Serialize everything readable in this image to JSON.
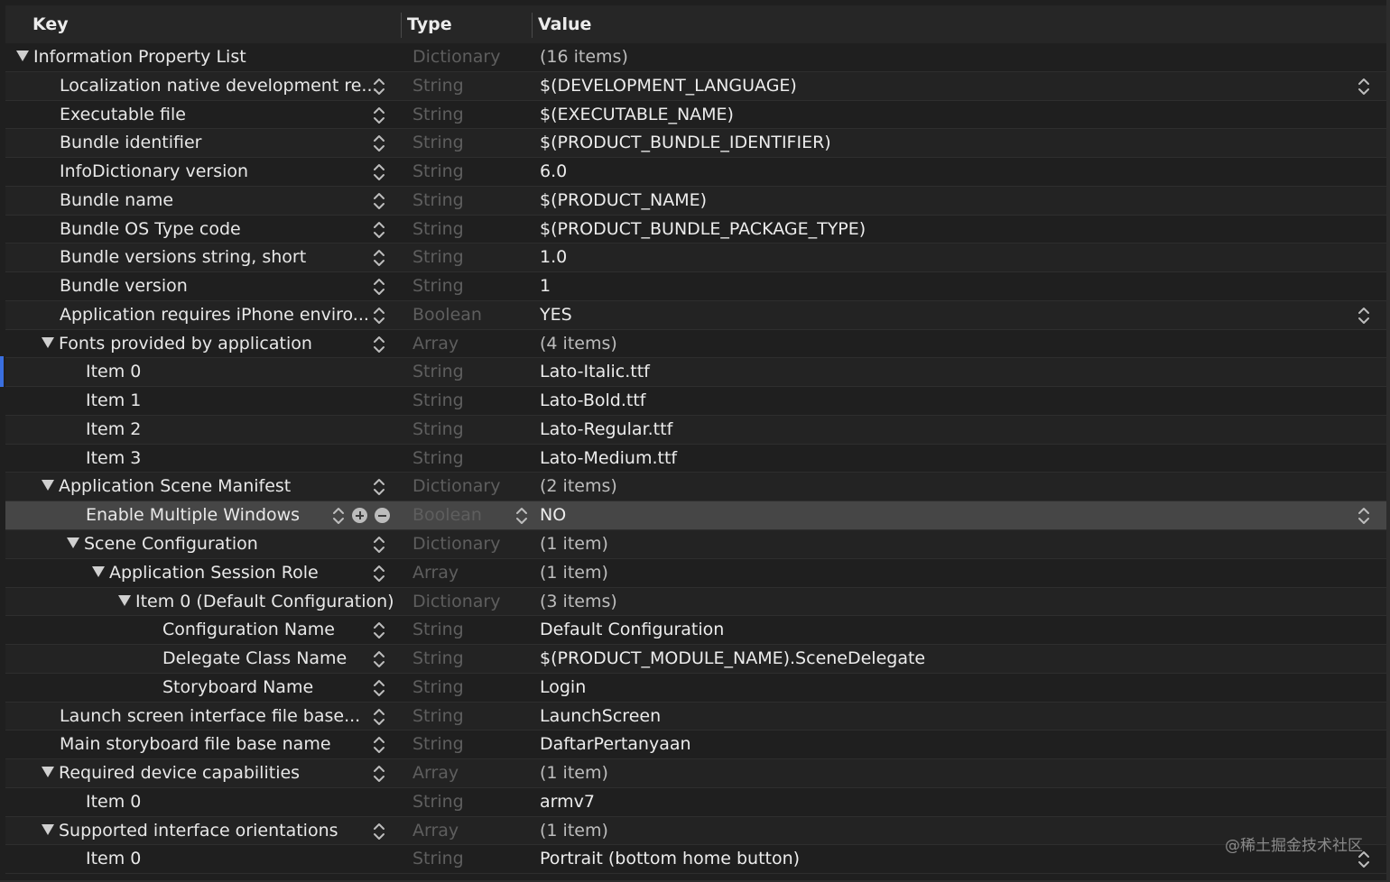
{
  "header": {
    "key_label": "Key",
    "type_label": "Type",
    "value_label": "Value"
  },
  "rows": [
    {
      "key": "Information Property List",
      "type": "Dictionary",
      "value": "(16 items)"
    },
    {
      "key": "Localization native development re...",
      "type": "String",
      "value": "$(DEVELOPMENT_LANGUAGE)"
    },
    {
      "key": "Executable file",
      "type": "String",
      "value": "$(EXECUTABLE_NAME)"
    },
    {
      "key": "Bundle identifier",
      "type": "String",
      "value": "$(PRODUCT_BUNDLE_IDENTIFIER)"
    },
    {
      "key": "InfoDictionary version",
      "type": "String",
      "value": "6.0"
    },
    {
      "key": "Bundle name",
      "type": "String",
      "value": "$(PRODUCT_NAME)"
    },
    {
      "key": "Bundle OS Type code",
      "type": "String",
      "value": "$(PRODUCT_BUNDLE_PACKAGE_TYPE)"
    },
    {
      "key": "Bundle versions string, short",
      "type": "String",
      "value": "1.0"
    },
    {
      "key": "Bundle version",
      "type": "String",
      "value": "1"
    },
    {
      "key": "Application requires iPhone enviro...",
      "type": "Boolean",
      "value": "YES"
    },
    {
      "key": "Fonts provided by application",
      "type": "Array",
      "value": "(4 items)"
    },
    {
      "key": "Item 0",
      "type": "String",
      "value": "Lato-Italic.ttf"
    },
    {
      "key": "Item 1",
      "type": "String",
      "value": "Lato-Bold.ttf"
    },
    {
      "key": "Item 2",
      "type": "String",
      "value": "Lato-Regular.ttf"
    },
    {
      "key": "Item 3",
      "type": "String",
      "value": "Lato-Medium.ttf"
    },
    {
      "key": "Application Scene Manifest",
      "type": "Dictionary",
      "value": "(2 items)"
    },
    {
      "key": "Enable Multiple Windows",
      "type": "Boolean",
      "value": "NO"
    },
    {
      "key": "Scene Configuration",
      "type": "Dictionary",
      "value": "(1 item)"
    },
    {
      "key": "Application Session Role",
      "type": "Array",
      "value": "(1 item)"
    },
    {
      "key": "Item 0 (Default Configuration)",
      "type": "Dictionary",
      "value": "(3 items)"
    },
    {
      "key": "Configuration Name",
      "type": "String",
      "value": "Default Configuration"
    },
    {
      "key": "Delegate Class Name",
      "type": "String",
      "value": "$(PRODUCT_MODULE_NAME).SceneDelegate"
    },
    {
      "key": "Storyboard Name",
      "type": "String",
      "value": "Login"
    },
    {
      "key": "Launch screen interface file base...",
      "type": "String",
      "value": "LaunchScreen"
    },
    {
      "key": "Main storyboard file base name",
      "type": "String",
      "value": "DaftarPertanyaan"
    },
    {
      "key": "Required device capabilities",
      "type": "Array",
      "value": "(1 item)"
    },
    {
      "key": "Item 0",
      "type": "String",
      "value": "armv7"
    },
    {
      "key": "Supported interface orientations",
      "type": "Array",
      "value": "(1 item)"
    },
    {
      "key": "Item 0",
      "type": "String",
      "value": "Portrait (bottom home button)"
    }
  ],
  "watermark": "@稀土掘金技术社区",
  "colors": {
    "background": "#1f1f1f",
    "selected_row": "#464646",
    "type_text": "#5e5e5e",
    "selection_marker": "#3a6fe0"
  }
}
